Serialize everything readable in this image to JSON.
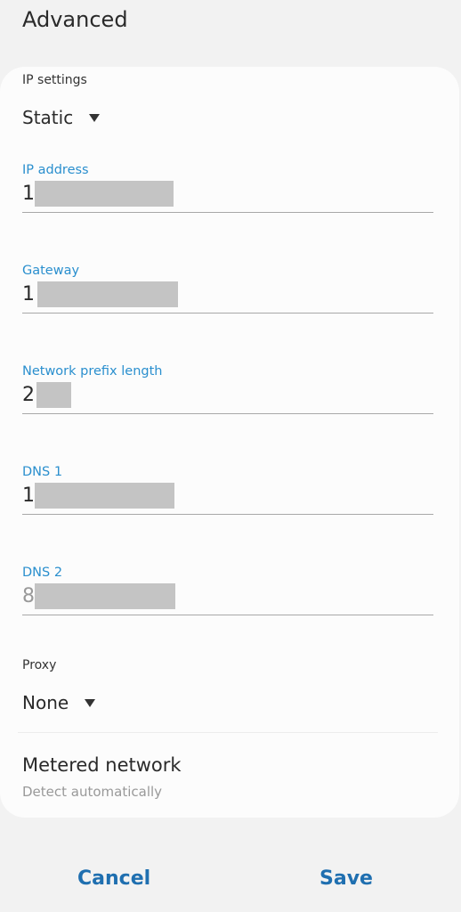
{
  "header": {
    "title": "Advanced"
  },
  "ip_settings": {
    "label": "IP settings",
    "value": "Static"
  },
  "fields": [
    {
      "label": "IP address",
      "value": "1"
    },
    {
      "label": "Gateway",
      "value": "1"
    },
    {
      "label": "Network prefix length",
      "value": "2"
    },
    {
      "label": "DNS 1",
      "value": "1"
    },
    {
      "label": "DNS 2",
      "value": "8"
    }
  ],
  "proxy": {
    "label": "Proxy",
    "value": "None"
  },
  "metered": {
    "title": "Metered network",
    "subtitle": "Detect automatically"
  },
  "actions": {
    "cancel": "Cancel",
    "save": "Save"
  },
  "colors": {
    "accent": "#2a8fce",
    "button": "#1f6fb0",
    "background": "#f2f2f2"
  },
  "icons": {
    "dropdown": "caret-down-icon"
  }
}
